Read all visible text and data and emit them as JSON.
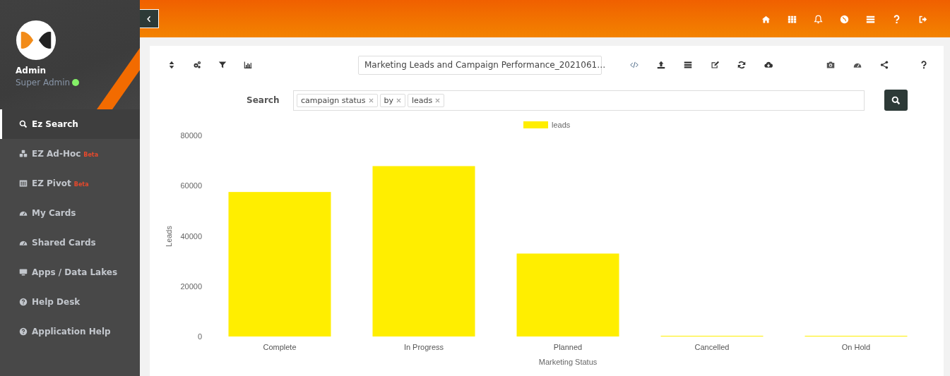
{
  "sidebar": {
    "user": {
      "name": "Admin",
      "role": "Super Admin",
      "online": true
    },
    "items": [
      {
        "label": "Ez Search",
        "selected": true
      },
      {
        "label": "EZ Ad-Hoc",
        "badge": "Beta",
        "selected": false
      },
      {
        "label": "EZ Pivot",
        "badge": "Beta",
        "selected": false
      },
      {
        "label": "My Cards",
        "selected": false
      },
      {
        "label": "Shared Cards",
        "selected": false
      },
      {
        "label": "Apps / Data Lakes",
        "selected": false
      },
      {
        "label": "Help Desk",
        "selected": false
      },
      {
        "label": "Application Help",
        "selected": false
      }
    ]
  },
  "report": {
    "selected": "Marketing Leads and Campaign Performance_2021061…"
  },
  "search": {
    "label": "Search",
    "tags": [
      "campaign status",
      "by",
      "leads"
    ]
  },
  "chart_data": {
    "type": "bar",
    "xlabel": "Marketing Status",
    "ylabel": "Leads",
    "categories": [
      "Complete",
      "In Progress",
      "Planned",
      "Cancelled",
      "On Hold"
    ],
    "series": [
      {
        "name": "leads",
        "color": "#ffee00",
        "values": [
          57500,
          67800,
          33000,
          200,
          100
        ]
      }
    ],
    "ylim": [
      0,
      80000
    ],
    "yticks": [
      0,
      20000,
      40000,
      60000,
      80000
    ]
  }
}
